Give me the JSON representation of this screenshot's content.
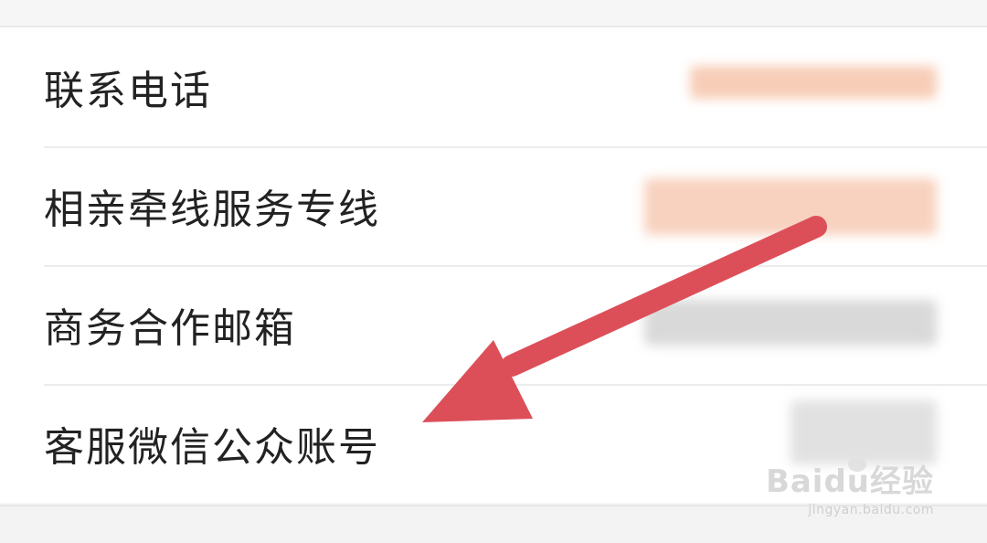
{
  "rows": [
    {
      "label": "联系电话"
    },
    {
      "label": "相亲牵线服务专线"
    },
    {
      "label": "商务合作邮箱"
    },
    {
      "label": "客服微信公众账号"
    }
  ],
  "watermark": {
    "brand": "Baidu经验",
    "url": "jingyan.baidu.com"
  },
  "colors": {
    "arrow": "#dc4f59",
    "peach_blur": "#f6c8b0",
    "gray_blur": "#d6d6d6"
  }
}
